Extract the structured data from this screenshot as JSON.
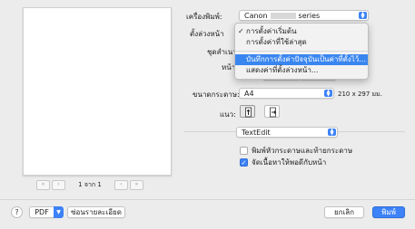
{
  "pager": {
    "first": "«",
    "prev": "‹",
    "label": "1 จาก 1",
    "next": "›",
    "last": "»"
  },
  "fields": {
    "printer_label": "เครื่องพิมพ์:",
    "printer_value_prefix": "Canon",
    "printer_value_suffix": "series",
    "presets_label": "ตั้งล่วงหน้า",
    "copies_label": "ชุดสำเนา",
    "pages_label": "หน้า",
    "paper_size_label": "ขนาดกระดาษ:",
    "paper_size_value": "A4",
    "paper_size_dims": "210 x 297 มม.",
    "orientation_label": "แนว:",
    "app_section_value": "TextEdit"
  },
  "presets_menu": {
    "items": [
      {
        "label": "การตั้งค่าเริ่มต้น",
        "checked": "✓"
      },
      {
        "label": "การตั้งค่าที่ใช้ล่าสุด",
        "checked": ""
      }
    ],
    "actions": [
      {
        "label": "บันทึกการตั้งค่าปัจจุบันเป็นค่าที่ตั้งไว้..."
      },
      {
        "label": "แสดงค่าที่ตั้งล่วงหน้า..."
      }
    ]
  },
  "options": {
    "print_header_footer": "พิมพ์หัวกระดาษและท้ายกระดาษ",
    "print_header_footer_checked": false,
    "fit_content": "จัดเนื้อหาให้พอดีกับหน้า",
    "fit_content_checked": true
  },
  "footer": {
    "help": "?",
    "pdf": "PDF",
    "hide_details": "ซ่อนรายละเอียด",
    "cancel": "ยกเลิก",
    "print": "พิมพ์"
  },
  "colors": {
    "accent": "#3d82f6",
    "highlight": "#3a86f0"
  }
}
